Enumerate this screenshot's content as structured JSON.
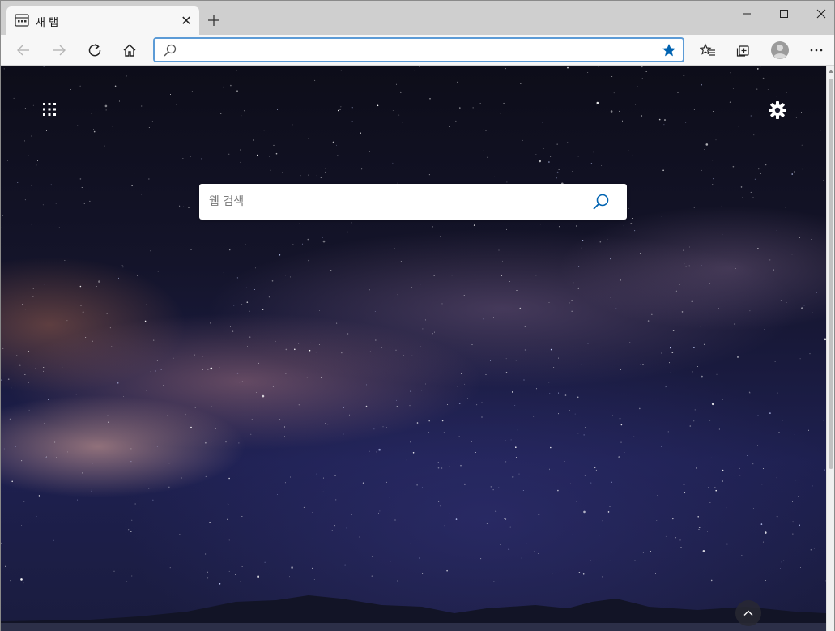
{
  "tab": {
    "title": "새 탭",
    "close_label": "✕",
    "new_tab_label": "+"
  },
  "window_controls": {
    "minimize": "minimize",
    "maximize": "maximize",
    "close": "close"
  },
  "toolbar": {
    "address_value": "",
    "address_placeholder": "",
    "icons": [
      "back-icon",
      "forward-icon",
      "refresh-icon",
      "home-icon",
      "favorites-icon",
      "collections-icon",
      "profile-icon",
      "more-icon"
    ]
  },
  "newtab": {
    "search_placeholder": "웹 검색",
    "search_value": ""
  },
  "colors": {
    "accent": "#0063b1",
    "address_border": "#5c9bd6",
    "tabbar_bg": "#cfcfcf",
    "toolbar_bg": "#f7f7f7"
  }
}
